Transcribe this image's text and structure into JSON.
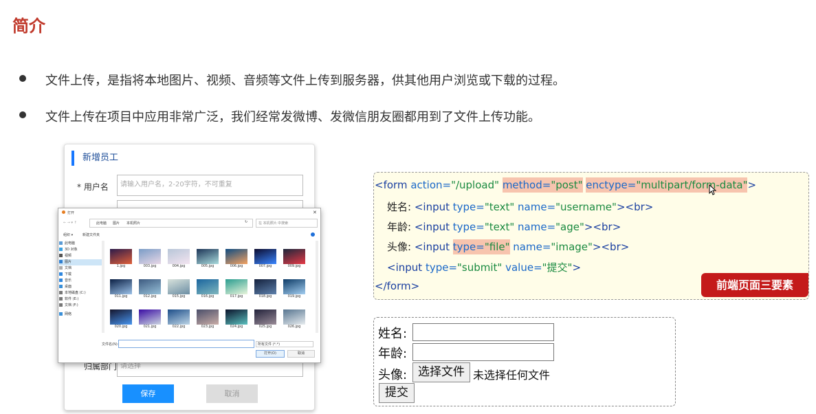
{
  "section": {
    "title": "简介",
    "bullets": [
      "文件上传，是指将本地图片、视频、音频等文件上传到服务器，供其他用户浏览或下载的过程。",
      "文件上传在项目中应用非常广泛，我们经常发微博、发微信朋友圈都用到了文件上传功能。"
    ]
  },
  "card": {
    "header": "新增员工",
    "username_label": "* 用户名",
    "username_placeholder": "请输入用户名，2-20字符，不可重复",
    "dept_label": "归属部门",
    "dept_placeholder": "请选择",
    "save_label": "保存",
    "cancel_label": "取消",
    "colors": {
      "accent": "#1890ff",
      "header_bar": "#1677ff"
    }
  },
  "dialog": {
    "title": "打开",
    "path": [
      "此电脑",
      "图片",
      "本机照片"
    ],
    "search_placeholder": "在 本机照片 中搜索",
    "toolbar": [
      "组织 ▾",
      "新建文件夹"
    ],
    "sidebar": [
      "此电脑",
      "3D 对象",
      "视频",
      "图片",
      "文档",
      "下载",
      "音乐",
      "桌面",
      "本地磁盘 (C:)",
      "软件 (E:)",
      "文档 (F:)",
      "网络"
    ],
    "files": [
      "1.jpg",
      "003.jpg",
      "004.jpg",
      "005.jpg",
      "006.jpg",
      "007.jpg",
      "009.jpg",
      "011.jpg",
      "012.jpg",
      "015.jpg",
      "016.jpg",
      "017.jpg",
      "018.jpg",
      "019.jpg",
      "020.jpg",
      "021.jpg",
      "022.jpg",
      "023.jpg",
      "024.jpg",
      "025.jpg",
      "026.jpg"
    ],
    "filename_label": "文件名(N):",
    "filter": "所有文件 (*.*)",
    "open_label": "打开(O)",
    "cancel_label": "取消"
  },
  "code": {
    "l1": {
      "open": "<form",
      "a1": "action=",
      "v1": "\"/upload\"",
      "a2": "method=",
      "v2": "\"post\"",
      "a3": "enctype=",
      "v3": "\"multipart/form-data\"",
      "close": ">"
    },
    "l2": {
      "label": "姓名: ",
      "open": "<input",
      "a1": "type=",
      "v1": "\"text\"",
      "a2": "name=",
      "v2": "\"username\"",
      "close": "><br>"
    },
    "l3": {
      "label": "年龄: ",
      "open": "<input",
      "a1": "type=",
      "v1": "\"text\"",
      "a2": "name=",
      "v2": "\"age\"",
      "close": "><br>"
    },
    "l4": {
      "label": "头像: ",
      "open": "<input",
      "a1": "type=",
      "v1": "\"file\"",
      "a2": "name=",
      "v2": "\"image\"",
      "close": "><br>"
    },
    "l5": {
      "open": "<input",
      "a1": "type=",
      "v1": "\"submit\"",
      "a2": "value=",
      "v2": "\"提交\"",
      "close": ">"
    },
    "l6": "</form>",
    "badge": "前端页面三要素",
    "colors": {
      "highlight": "#f7c4ae",
      "badge": "#c41a1a",
      "box": "#fffde8"
    }
  },
  "rendered": {
    "name_label": "姓名:",
    "age_label": "年龄:",
    "avatar_label": "头像:",
    "choose_file": "选择文件",
    "no_file": "未选择任何文件",
    "submit": "提交"
  }
}
